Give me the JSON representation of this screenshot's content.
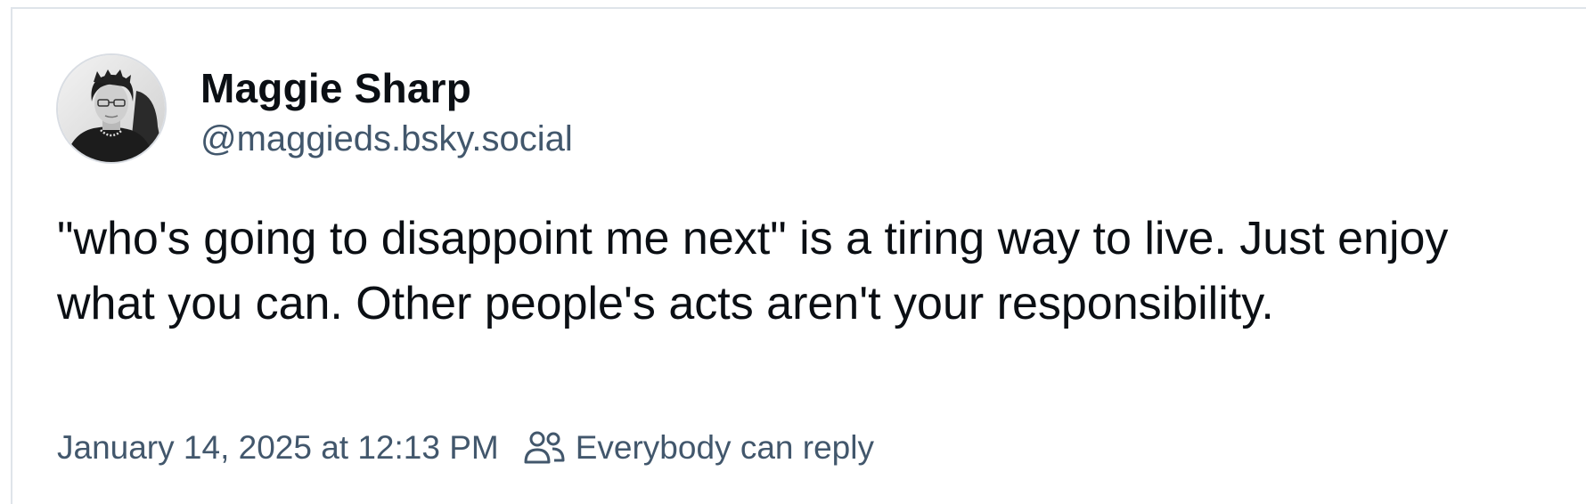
{
  "post": {
    "author": {
      "display_name": "Maggie Sharp",
      "handle": "@maggieds.bsky.social"
    },
    "text": "\"who's going to disappoint me next\" is a tiring way to live. Just enjoy what you can. Other people's acts aren't your responsibility.",
    "timestamp": "January 14, 2025 at 12:13 PM",
    "reply_setting": "Everybody can reply",
    "icons": {
      "reply_setting_icon": "people-icon"
    }
  },
  "colors": {
    "text_primary": "#0b0f14",
    "text_secondary": "#42576c",
    "border": "#dfe4ea"
  }
}
